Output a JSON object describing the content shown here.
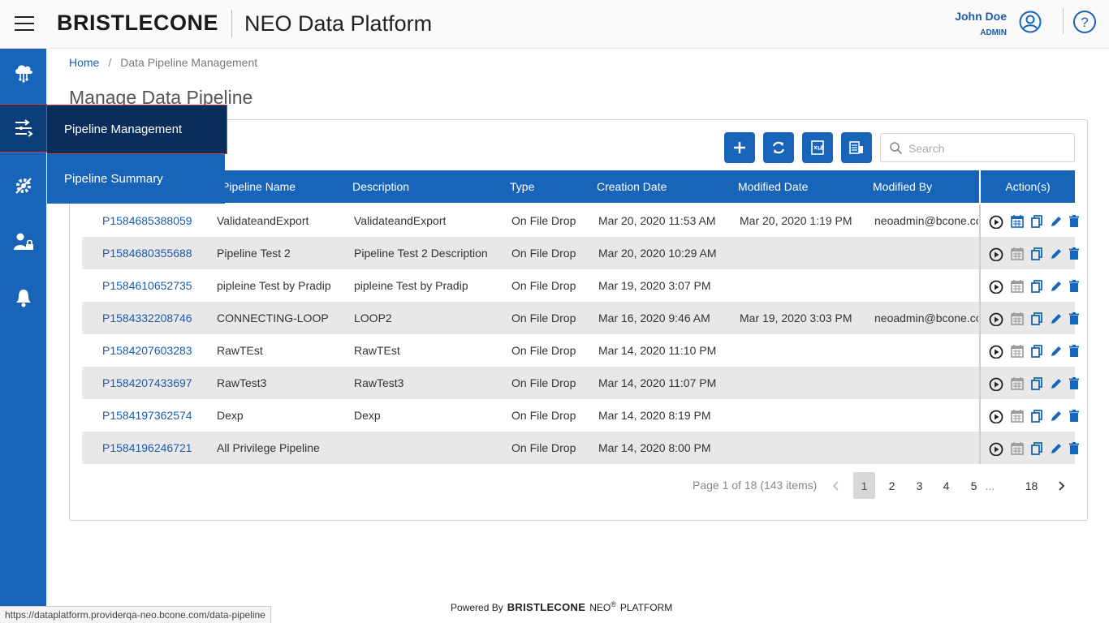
{
  "header": {
    "logo_text": "BRISTLECONE",
    "app_title": "NEO Data Platform",
    "user_name": "John Doe",
    "user_role": "ADMIN",
    "icons": [
      "menu-icon",
      "user-icon",
      "help-icon"
    ]
  },
  "sidenav": {
    "items": [
      {
        "name": "cloud-network-icon",
        "active": false
      },
      {
        "name": "pipeline-icon",
        "active": true
      },
      {
        "name": "settings-icon",
        "active": false
      },
      {
        "name": "user-admin-icon",
        "active": false
      },
      {
        "name": "bell-icon",
        "active": false
      }
    ]
  },
  "flyout": {
    "items": [
      {
        "label": "Pipeline Management",
        "active": true
      },
      {
        "label": "Pipeline Summary",
        "active": false
      }
    ]
  },
  "breadcrumb": {
    "home": "Home",
    "separator": "/",
    "current": "Data Pipeline Management"
  },
  "page_title": "Manage Data Pipeline",
  "toolbar": {
    "buttons": [
      "add-icon",
      "refresh-icon",
      "export-xls-icon",
      "column-settings-icon"
    ],
    "search_placeholder": "Search"
  },
  "table": {
    "columns": {
      "id": "",
      "name": "Pipeline Name",
      "description": "Description",
      "type": "Type",
      "created": "Creation Date",
      "modified": "Modified Date",
      "modified_by": "Modified By",
      "actions": "Action(s)"
    },
    "rows": [
      {
        "id": "P1584685388059",
        "name": "ValidateandExport",
        "description": "ValidateandExport",
        "type": "On File Drop",
        "created": "Mar 20, 2020 11:53 AM",
        "modified": "Mar 20, 2020 1:19 PM",
        "modified_by": "neoadmin@bcone.co",
        "scheduled": true
      },
      {
        "id": "P1584680355688",
        "name": "Pipeline Test 2",
        "description": "Pipeline Test 2 Description",
        "type": "On File Drop",
        "created": "Mar 20, 2020 10:29 AM",
        "modified": "",
        "modified_by": "",
        "scheduled": false
      },
      {
        "id": "P1584610652735",
        "name": "pipleine Test by Pradip",
        "description": "pipleine Test by Pradip",
        "type": "On File Drop",
        "created": "Mar 19, 2020 3:07 PM",
        "modified": "",
        "modified_by": "",
        "scheduled": false
      },
      {
        "id": "P1584332208746",
        "name": "CONNECTING-LOOP",
        "description": "LOOP2",
        "type": "On File Drop",
        "created": "Mar 16, 2020 9:46 AM",
        "modified": "Mar 19, 2020 3:03 PM",
        "modified_by": "neoadmin@bcone.co",
        "scheduled": false
      },
      {
        "id": "P1584207603283",
        "name": "RawTEst",
        "description": "RawTEst",
        "type": "On File Drop",
        "created": "Mar 14, 2020 11:10 PM",
        "modified": "",
        "modified_by": "",
        "scheduled": false
      },
      {
        "id": "P1584207433697",
        "name": "RawTest3",
        "description": "RawTest3",
        "type": "On File Drop",
        "created": "Mar 14, 2020 11:07 PM",
        "modified": "",
        "modified_by": "",
        "scheduled": false
      },
      {
        "id": "P1584197362574",
        "name": "Dexp",
        "description": "Dexp",
        "type": "On File Drop",
        "created": "Mar 14, 2020 8:19 PM",
        "modified": "",
        "modified_by": "",
        "scheduled": false
      },
      {
        "id": "P1584196246721",
        "name": "All Privilege Pipeline",
        "description": "",
        "type": "On File Drop",
        "created": "Mar 14, 2020 8:00 PM",
        "modified": "",
        "modified_by": "",
        "scheduled": false
      }
    ],
    "row_actions": [
      "run-icon",
      "schedule-icon",
      "copy-icon",
      "edit-icon",
      "delete-icon"
    ]
  },
  "pagination": {
    "info": "Page 1 of 18 (143 items)",
    "pages": [
      "1",
      "2",
      "3",
      "4",
      "5",
      "...",
      "18"
    ],
    "current": "1"
  },
  "footer": {
    "powered_by": "Powered By",
    "brand": "BRISTLECONE",
    "product": "NEO",
    "registered": "®",
    "platform": "PLATFORM"
  },
  "status_url": "https://dataplatform.providerqa-neo.bcone.com/data-pipeline",
  "colors": {
    "primary": "#1764b8",
    "sidenav_active": "#0c3f78",
    "flyout_active": "#0a2e5c",
    "link": "#1e5aa8",
    "row_alt": "#e8e8e8"
  }
}
